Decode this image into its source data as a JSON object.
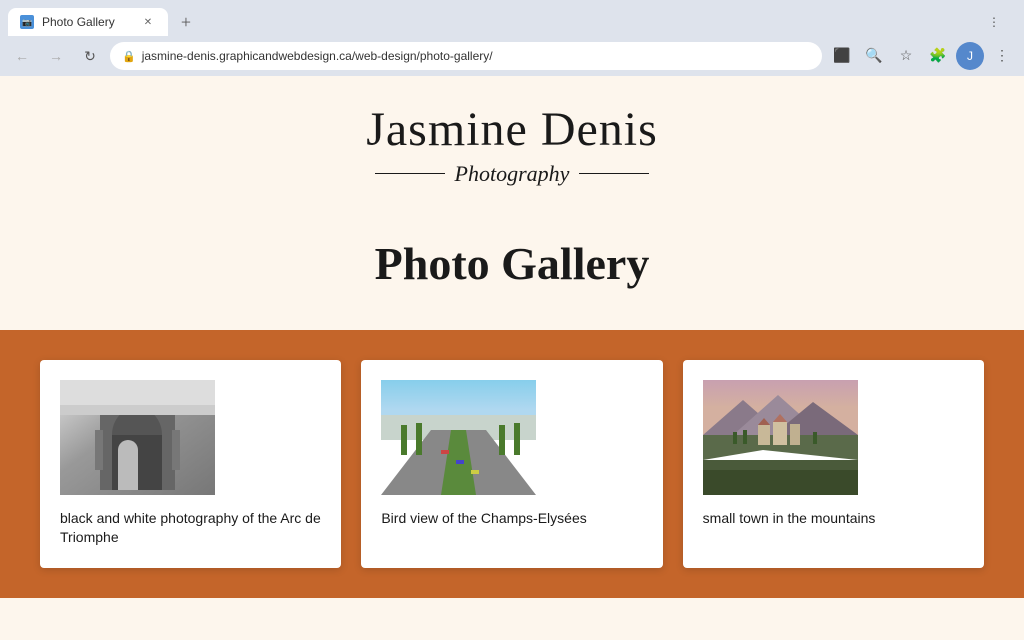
{
  "browser": {
    "tab_title": "Photo Gallery",
    "tab_favicon": "📷",
    "url": "jasmine-denis.graphicandwebdesign.ca/web-design/photo-gallery/",
    "new_tab_icon": "+",
    "back_label": "←",
    "forward_label": "→",
    "refresh_label": "↻"
  },
  "site": {
    "title_main": "Jasmine Denis",
    "title_sub": "Photography",
    "page_title": "Photo Gallery"
  },
  "gallery": {
    "background_color": "#c4652a",
    "items": [
      {
        "id": "arc-triomphe",
        "caption": "black and white photography of the Arc de Triomphe",
        "image_type": "arc_triomphe"
      },
      {
        "id": "champs-elysees",
        "caption": "Bird view of the Champs-Elysées",
        "image_type": "champs_elysees"
      },
      {
        "id": "mountain-town",
        "caption": "small town in the mountains",
        "image_type": "mountain_town"
      }
    ]
  }
}
